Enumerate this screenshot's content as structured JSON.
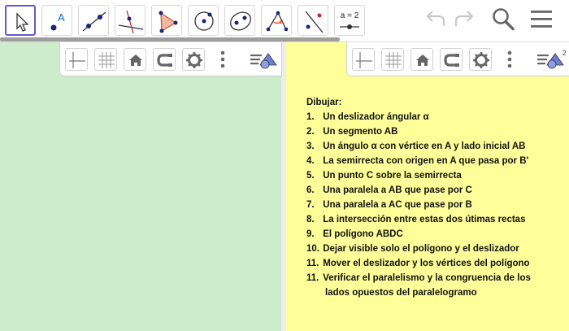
{
  "toolbar": {
    "tools": [
      {
        "name": "move-tool",
        "icon": "pointer-arrow-icon",
        "selected": true
      },
      {
        "name": "point-tool",
        "icon": "point-icon"
      },
      {
        "name": "line-tool",
        "icon": "line-through-two-points-icon"
      },
      {
        "name": "perpendicular-line-tool",
        "icon": "perpendicular-line-icon"
      },
      {
        "name": "polygon-tool",
        "icon": "polygon-icon"
      },
      {
        "name": "circle-tool",
        "icon": "circle-center-point-icon"
      },
      {
        "name": "ellipse-tool",
        "icon": "ellipse-icon"
      },
      {
        "name": "angle-tool",
        "icon": "angle-icon"
      },
      {
        "name": "reflect-tool",
        "icon": "reflect-about-line-icon"
      },
      {
        "name": "slider-tool",
        "icon": "slider-icon",
        "label": "a = 2"
      }
    ],
    "right": [
      "undo-icon",
      "redo-icon",
      "search-icon",
      "menu-icon"
    ],
    "accent_color": "#6557d2"
  },
  "graphics_view": {
    "background": "#cceccc",
    "stylebar": [
      "axes-icon",
      "grid-icon",
      "home-icon",
      "point-capturing-icon",
      "settings-icon",
      "more-icon",
      "style-bar-toggle-icon"
    ]
  },
  "graphics_view_2": {
    "background": "#ffff9a",
    "stylebar": [
      "axes-icon",
      "grid-icon",
      "home-icon",
      "point-capturing-icon",
      "settings-icon",
      "more-icon",
      "style-bar-toggle-2-icon"
    ],
    "toggle_badge": "2"
  },
  "construction_text": {
    "title": "Dibujar:",
    "steps": [
      {
        "num": "1.",
        "text": "Un deslizador ángular α"
      },
      {
        "num": "2.",
        "text": "Un segmento AB"
      },
      {
        "num": "3.",
        "text": "Un ángulo α con vértice en A y lado inicial AB"
      },
      {
        "num": "4.",
        "text": "La semirrecta con origen en A que pasa por B'"
      },
      {
        "num": "5.",
        "text": "Un punto C sobre la semirrecta"
      },
      {
        "num": "6.",
        "text": "Una paralela a AB que pase por C"
      },
      {
        "num": "7.",
        "text": "Una paralela a AC que pase por B"
      },
      {
        "num": "8.",
        "text": "La intersección entre estas dos útimas rectas"
      },
      {
        "num": "9.",
        "text": "El polígono ABDC"
      },
      {
        "num": "10.",
        "text": "Dejar visible solo el polígono y el deslizador"
      },
      {
        "num": "11.",
        "text": "Mover el deslizador y los vértices del polígono"
      },
      {
        "num": "11.",
        "text": "Verificar el paralelismo y la congruencia de los"
      }
    ],
    "continuation": "lados opuestos del paralelogramo"
  }
}
